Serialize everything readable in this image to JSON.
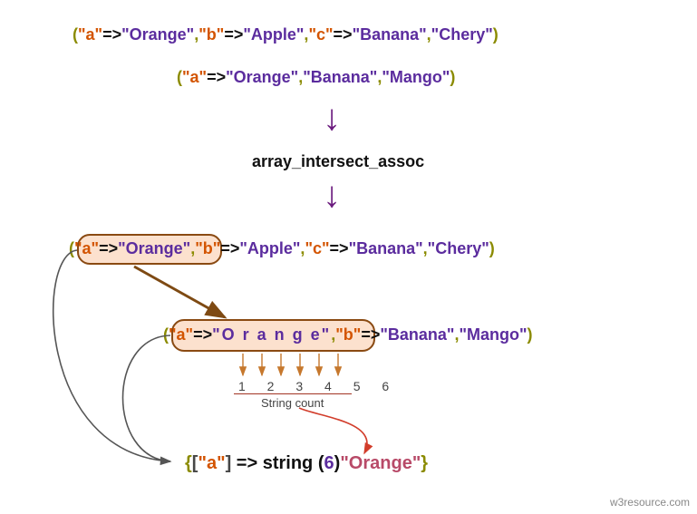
{
  "arrays": {
    "a1": {
      "pairs": [
        {
          "key": "\"a\"",
          "val": "\"Orange\""
        },
        {
          "key": "\"b\"",
          "val": "\"Apple\""
        },
        {
          "key": "\"c\"",
          "val": "\"Banana\""
        }
      ],
      "tail": "\"Chery\""
    },
    "a2": {
      "pairs": [
        {
          "key": "\"a\"",
          "val": "\"Orange\""
        }
      ],
      "tail1": "\"Banana\"",
      "tail2": "\"Mango\""
    }
  },
  "function_name": "array_intersect_assoc",
  "detailed": {
    "row3": {
      "hpair_key": "\"a\"",
      "hpair_val": "\"Orange\"",
      "rest": [
        {
          "key": "\"b\"",
          "val": "\"Apple\""
        },
        {
          "key": "\"c\"",
          "val": "\"Banana\""
        }
      ],
      "tail": "\"Chery\""
    },
    "row4": {
      "hpair_key": "\"a\"",
      "hpair_val_spaced": "\"O r a n g e\"",
      "rest": [
        {
          "key": "\"b\"",
          "val": "\"Banana\""
        }
      ],
      "tail": "\"Mango\""
    }
  },
  "string_count": {
    "numbers": "1 2 3 4 5 6",
    "label": "String count"
  },
  "result": {
    "open": "{",
    "before_key": "[",
    "key": "\"a\"",
    "after_key": "]",
    "arrow": " => ",
    "stringword": "string ",
    "countopen": "(",
    "count": "6",
    "countclose": ")",
    "value": "\"Orange\"",
    "close": "}"
  },
  "watermark": "w3resource.com"
}
